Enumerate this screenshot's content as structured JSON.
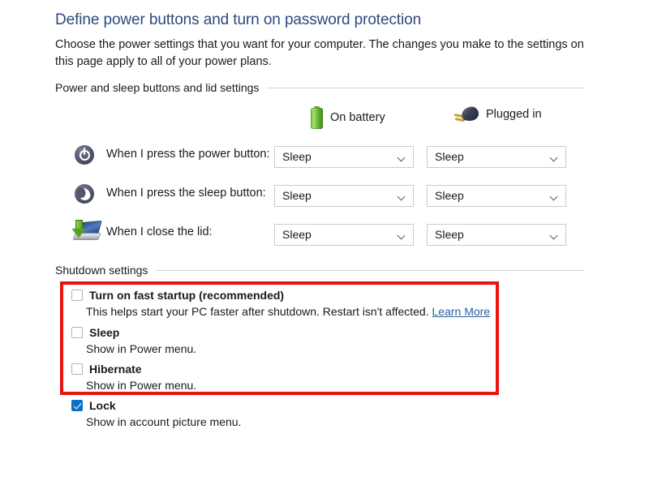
{
  "page": {
    "title": "Define power buttons and turn on password protection",
    "intro": "Choose the power settings that you want for your computer. The changes you make to the settings on this page apply to all of your power plans."
  },
  "power_section": {
    "header": "Power and sleep buttons and lid settings",
    "columns": [
      {
        "label": "On battery",
        "icon": "battery-icon"
      },
      {
        "label": "Plugged in",
        "icon": "power-plug-icon"
      }
    ],
    "rows": [
      {
        "icon": "power-button-icon",
        "label": "When I press the power button:",
        "on_battery": "Sleep",
        "plugged_in": "Sleep"
      },
      {
        "icon": "sleep-button-icon",
        "label": "When I press the sleep button:",
        "on_battery": "Sleep",
        "plugged_in": "Sleep"
      },
      {
        "icon": "laptop-lid-icon",
        "label": "When I close the lid:",
        "on_battery": "Sleep",
        "plugged_in": "Sleep"
      }
    ]
  },
  "shutdown_section": {
    "header": "Shutdown settings",
    "items": [
      {
        "label": "Turn on fast startup (recommended)",
        "description": "This helps start your PC faster after shutdown. Restart isn't affected.",
        "link": "Learn More",
        "checked": false
      },
      {
        "label": "Sleep",
        "description": "Show in Power menu.",
        "link": "",
        "checked": false
      },
      {
        "label": "Hibernate",
        "description": "Show in Power menu.",
        "link": "",
        "checked": false
      },
      {
        "label": "Lock",
        "description": "Show in account picture menu.",
        "link": "",
        "checked": true
      }
    ]
  },
  "annotation": {
    "color": "#e81313",
    "shape": "rectangle-highlight"
  },
  "colors": {
    "title": "#2b4a7d",
    "link": "#2b5f9e",
    "checkbox_checked": "#0b71c4",
    "annotation_red": "#e81313"
  }
}
